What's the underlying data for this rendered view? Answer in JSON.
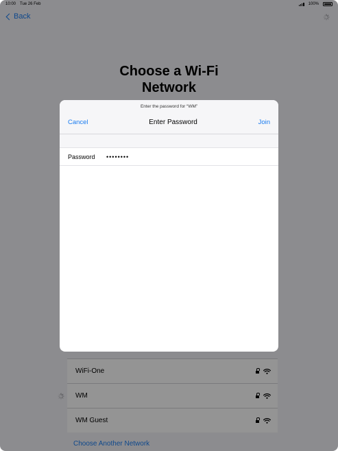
{
  "status_bar": {
    "time": "10:00",
    "date": "Tue 26 Feb",
    "battery": "100%"
  },
  "nav": {
    "back_label": "Back"
  },
  "page": {
    "title_line1": "Choose a Wi-Fi",
    "title_line2": "Network"
  },
  "networks": [
    {
      "name": "WiFi-One",
      "locked": true,
      "connecting": false
    },
    {
      "name": "WM",
      "locked": true,
      "connecting": true
    },
    {
      "name": "WM Guest",
      "locked": true,
      "connecting": false
    }
  ],
  "choose_another_label": "Choose Another Network",
  "modal": {
    "prompt": "Enter the password for “WM”",
    "cancel_label": "Cancel",
    "title": "Enter Password",
    "join_label": "Join",
    "password_label": "Password",
    "password_value": "••••••••"
  },
  "colors": {
    "accent": "#1a7cf0",
    "dim_overlay": "rgba(0,0,0,0.42)"
  }
}
